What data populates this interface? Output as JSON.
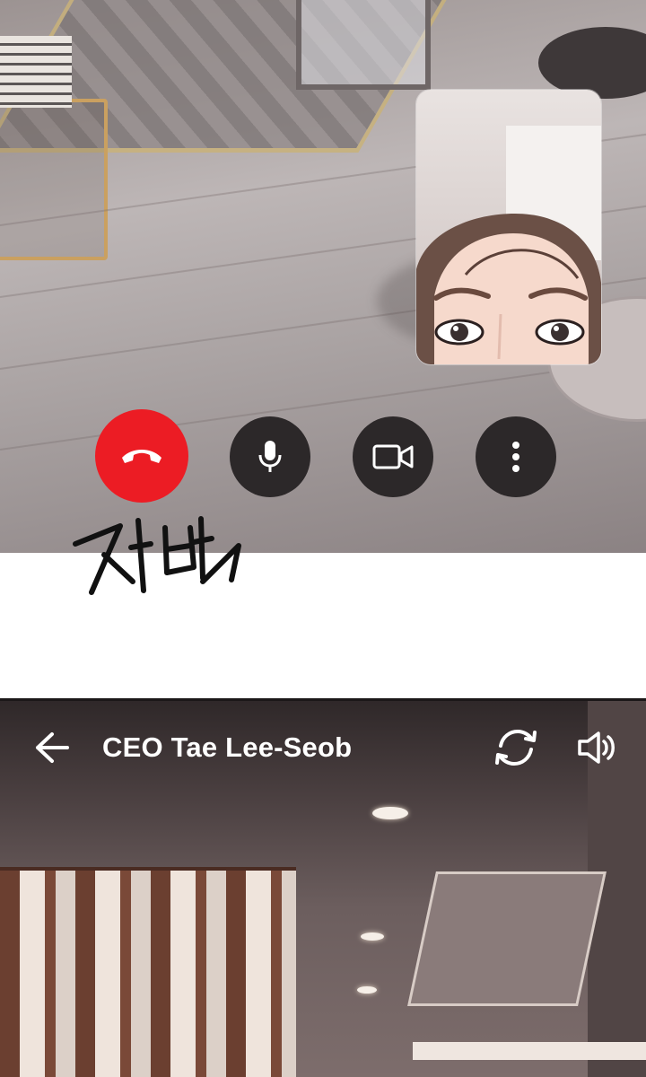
{
  "call_screen": {
    "controls": {
      "end_call": {
        "icon": "phone-hangup-icon",
        "color": "#ec1c24"
      },
      "microphone": {
        "icon": "microphone-icon"
      },
      "camera": {
        "icon": "video-camera-icon"
      },
      "more": {
        "icon": "more-vertical-icon"
      }
    },
    "sound_effect": "저벅"
  },
  "call_header": {
    "back_icon": "arrow-left-icon",
    "caller_name": "CEO Tae Lee-Seob",
    "switch_camera_icon": "camera-switch-icon",
    "speaker_icon": "speaker-icon"
  },
  "colors": {
    "end_call_red": "#ec1c24",
    "control_dark": "#2c2829",
    "header_text": "#ffffff"
  }
}
